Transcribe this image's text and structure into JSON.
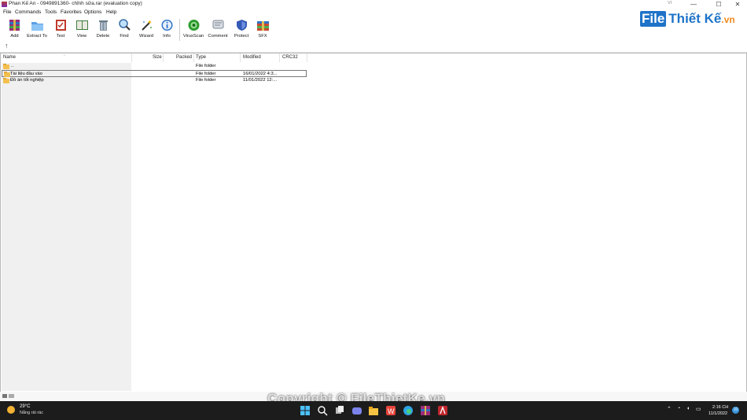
{
  "window": {
    "title": "Phan Kế An - 0949891360- chỉnh sửa.rar (evaluation copy)",
    "minimize": "—",
    "maximize": "☐",
    "close": "✕",
    "mini_label": "VI"
  },
  "menu": [
    "File",
    "Commands",
    "Tools",
    "Favorites",
    "Options",
    "Help"
  ],
  "toolbar": [
    {
      "label": "Add",
      "icon": "add-archive-icon"
    },
    {
      "label": "Extract To",
      "icon": "extract-folder-icon"
    },
    {
      "label": "Test",
      "icon": "test-checklist-icon"
    },
    {
      "label": "View",
      "icon": "view-book-icon"
    },
    {
      "label": "Delete",
      "icon": "trash-icon"
    },
    {
      "label": "Find",
      "icon": "magnifier-icon"
    },
    {
      "label": "Wizard",
      "icon": "magic-wand-icon"
    },
    {
      "label": "Info",
      "icon": "info-icon"
    },
    {
      "label": "VirusScan",
      "icon": "virus-scan-icon"
    },
    {
      "label": "Comment",
      "icon": "comment-icon"
    },
    {
      "label": "Protect",
      "icon": "shield-icon"
    },
    {
      "label": "SFX",
      "icon": "sfx-archive-icon"
    }
  ],
  "logo": {
    "part1": "File",
    "part2": "Thiết Kế",
    "part3": ".vn"
  },
  "address": {
    "up": "↑"
  },
  "columns": [
    "Name",
    "Size",
    "Packed",
    "Type",
    "Modified",
    "CRC32"
  ],
  "rows": [
    {
      "name": "..",
      "size": "",
      "packed": "",
      "type": "File folder",
      "modified": "",
      "crc": ""
    },
    {
      "name": "Tài liệu đầu vào",
      "size": "",
      "packed": "",
      "type": "File folder",
      "modified": "16/01/2022 4:3...",
      "crc": ""
    },
    {
      "name": "Đồ án tốt nghiệp",
      "size": "",
      "packed": "",
      "type": "File folder",
      "modified": "11/01/2022 12:...",
      "crc": ""
    }
  ],
  "taskbar": {
    "weather_temp": "29°C",
    "weather_desc": "Nắng rải rác",
    "time": "2:16 CH",
    "date": "11/1/2022",
    "notif_count": "10"
  },
  "watermark": "Copyright © FileThietKe.vn",
  "colors": {
    "logo_blue": "#1e73c8",
    "logo_orange": "#f08a1c",
    "taskbar": "#1c1c1c"
  }
}
